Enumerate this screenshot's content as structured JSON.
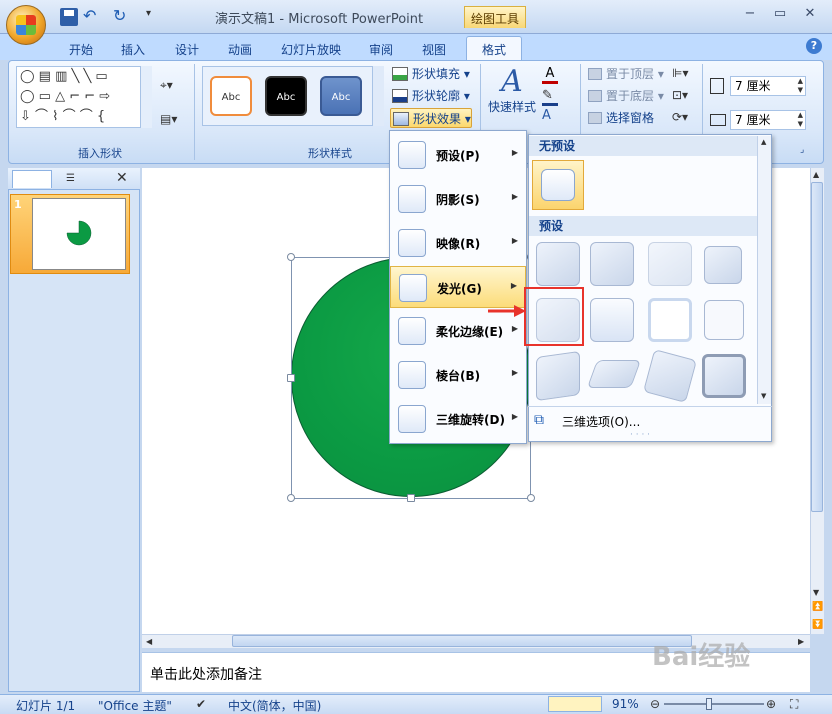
{
  "window": {
    "title": "演示文稿1 - Microsoft PowerPoint",
    "contextual_tab_group": "绘图工具",
    "min_symbol": "−",
    "max_symbol": "▭",
    "close_symbol": "✕"
  },
  "quick_access": {
    "undo": "↶",
    "redo": "↻",
    "more": "▾"
  },
  "tabs": [
    "开始",
    "插入",
    "设计",
    "动画",
    "幻灯片放映",
    "审阅",
    "视图",
    "格式"
  ],
  "ribbon": {
    "insert_shapes": {
      "label": "插入形状",
      "shapes_row1": "◯ ▤ ▥ ╲ ╲ ▭",
      "shapes_row2": "◯ ▭ △ ⌐ ⌐ ⇨",
      "shapes_row3": "⇩ ⌒ ⌇ ⌒ ⌒ {"
    },
    "shape_styles": {
      "label": "形状样式",
      "swatches": [
        "Abc",
        "Abc",
        "Abc"
      ],
      "fill": "形状填充",
      "outline": "形状轮廓",
      "effects": "形状效果"
    },
    "wordart": {
      "quick_styles_line1": "快速样式",
      "glyph": "A"
    },
    "arrange": {
      "bring_to_front": "置于顶层",
      "send_to_back": "置于底层",
      "selection_pane": "选择窗格"
    },
    "size": {
      "height": "7 厘米",
      "width": "7 厘米"
    }
  },
  "left_panel": {
    "close": "✕",
    "slide_number": "1"
  },
  "notes_placeholder": "单击此处添加备注",
  "status": {
    "slide": "幻灯片 1/1",
    "theme": "\"Office 主题\"",
    "language": "中文(简体，中国)",
    "zoom": "91%"
  },
  "effects_menu": {
    "items": [
      {
        "label": "预设(P)"
      },
      {
        "label": "阴影(S)"
      },
      {
        "label": "映像(R)"
      },
      {
        "label": "发光(G)"
      },
      {
        "label": "柔化边缘(E)"
      },
      {
        "label": "棱台(B)"
      },
      {
        "label": "三维旋转(D)"
      }
    ],
    "active_index": 3
  },
  "submenu": {
    "no_preset_header": "无预设",
    "preset_header": "预设",
    "options_label": "三维选项(O)...",
    "grip": "· · · ·"
  },
  "watermark": "Bai经验",
  "colors": {
    "shape_fill": "#0b9a43",
    "highlight": "#e8332b",
    "active_menu": "#fcdc7a"
  }
}
